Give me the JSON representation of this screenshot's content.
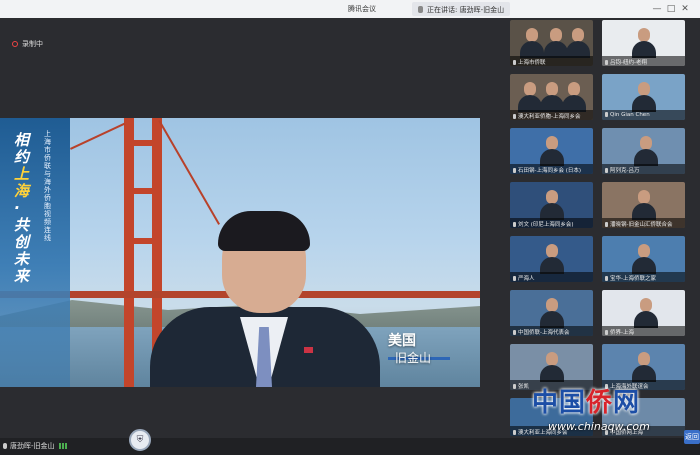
{
  "titlebar": {
    "app_title": "腾讯会议",
    "speaker": "正在讲话: 唐劲晖-旧金山",
    "minimize": "—",
    "maximize": "□",
    "close": "✕"
  },
  "recording": {
    "label": "录制中"
  },
  "video": {
    "banner_headline_1": "相约",
    "banner_headline_2": "上海",
    "banner_headline_3": "·共创未来",
    "banner_subtitle": "上海市侨联与海外侨胞视频连线",
    "country": "美国",
    "city": "旧金山"
  },
  "bottom": {
    "active_name": "唐劲晖-旧金山",
    "shield_icon": "shield-icon",
    "right_button": "返回"
  },
  "participants": [
    {
      "name": "上海市侨联"
    },
    {
      "name": "吕钧-纽约-老翔"
    },
    {
      "name": "澳大利亚侨胞-上海同乡会"
    },
    {
      "name": "Qin Gian Chen"
    },
    {
      "name": "石田钢-上海同乡会 (日本)"
    },
    {
      "name": "阿列克-吕万"
    },
    {
      "name": "刘文 (印尼上海同乡会)"
    },
    {
      "name": "潘晓钢-旧金山汇侨联合会"
    },
    {
      "name": "严海人"
    },
    {
      "name": "宝华-上海侨联之家"
    },
    {
      "name": "中国侨联-上海代表会"
    },
    {
      "name": "侨界-上海"
    },
    {
      "name": "张凯"
    },
    {
      "name": "上海海外联谊会"
    },
    {
      "name": "澳大利亚上海同乡会"
    },
    {
      "name": "中国侨网上海"
    }
  ],
  "watermark": {
    "logo_1": "中国",
    "logo_2": "侨",
    "logo_3": "网",
    "url": "www.chinaqw.com"
  },
  "colors": {
    "app_background": "#2b2c30",
    "titlebar": "#f2f3f5",
    "accent_blue": "#2d66b6",
    "banner_highlight": "#ffd23a",
    "bridge_red": "#c3452b"
  }
}
